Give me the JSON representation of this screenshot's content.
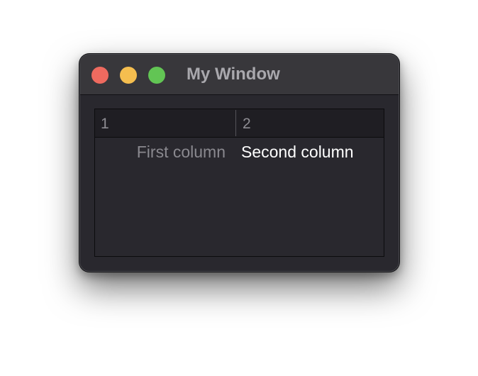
{
  "window": {
    "title": "My Window",
    "traffic_lights": {
      "close_color": "#ee6a5f",
      "minimize_color": "#f5be4f",
      "zoom_color": "#62c554"
    }
  },
  "table": {
    "headers": [
      "1",
      "2"
    ],
    "rows": [
      [
        "First column",
        "Second column"
      ]
    ]
  }
}
